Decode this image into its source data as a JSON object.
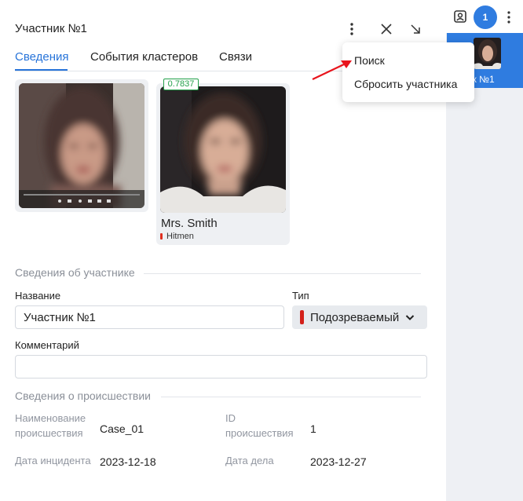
{
  "panel": {
    "title": "Участник №1"
  },
  "tabs": [
    {
      "label": "Сведения",
      "active": true
    },
    {
      "label": "События кластеров",
      "active": false
    },
    {
      "label": "Связи",
      "active": false
    }
  ],
  "icons": {
    "more": "more-vertical-icon",
    "close": "close-icon",
    "collapse": "arrow-down-right-icon",
    "person": "person-badge-icon"
  },
  "gallery": {
    "match_score": "0.7837",
    "person_name": "Mrs. Smith",
    "group_name": "Hitmen",
    "group_color": "#e03020"
  },
  "participant_section": {
    "heading": "Сведения об участнике",
    "name_label": "Название",
    "name_value": "Участник №1",
    "type_label": "Тип",
    "type_value": "Подозреваемый",
    "type_color": "#d3201a",
    "comment_label": "Комментарий",
    "comment_value": ""
  },
  "incident_section": {
    "heading": "Сведения о происшествии",
    "case_name_label_1": "Наименование",
    "case_name_label_2": "происшествия",
    "case_name_value": "Case_01",
    "case_id_label_1": "ID",
    "case_id_label_2": "происшествия",
    "case_id_value": "1",
    "incident_date_label": "Дата инцидента",
    "incident_date_value": "2023-12-18",
    "case_date_label": "Дата дела",
    "case_date_value": "2023-12-27"
  },
  "context_menu": {
    "items": [
      "Поиск",
      "Сбросить участника"
    ]
  },
  "right_sidebar": {
    "count": "1",
    "card_label": "астник №1"
  },
  "colors": {
    "accent": "#2874d9",
    "score": "#23a04a",
    "annotation_arrow": "#e8141c"
  }
}
